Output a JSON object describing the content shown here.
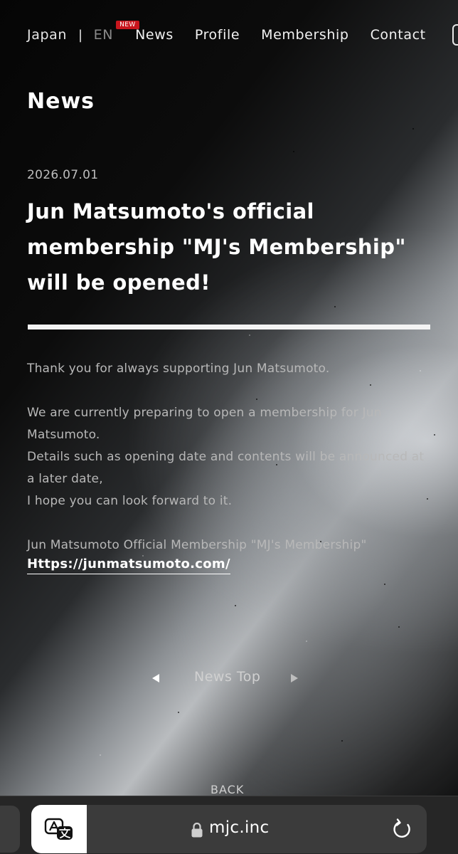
{
  "nav": {
    "lang_japan": "Japan",
    "separator": "|",
    "lang_en": "EN",
    "new_badge": "NEW",
    "items": [
      "News",
      "Profile",
      "Membership",
      "Contact"
    ]
  },
  "article": {
    "section_title": "News",
    "date": "2026.07.01",
    "headline": "Jun Matsumoto's official membership \"MJ's Membership\" will be opened!",
    "paragraph_1": "Thank you for always supporting Jun Matsumoto.",
    "paragraph_2_line_1": "We are currently preparing to open a membership for Jun Matsumoto.",
    "paragraph_2_line_2": "Details such as opening date and contents will be announced at a later date,",
    "paragraph_2_line_3": "I hope you can look forward to it.",
    "paragraph_3": "Jun Matsumoto Official Membership \"MJ's Membership\"",
    "link_text": "Https://junmatsumoto.com/"
  },
  "pager": {
    "news_top_label": "News Top",
    "back_label": "BACK"
  },
  "browser": {
    "url": "mjc.inc"
  },
  "colors": {
    "badge": "#c8161d",
    "text_muted": "#b8b8b8",
    "browser_bar": "#262626"
  }
}
